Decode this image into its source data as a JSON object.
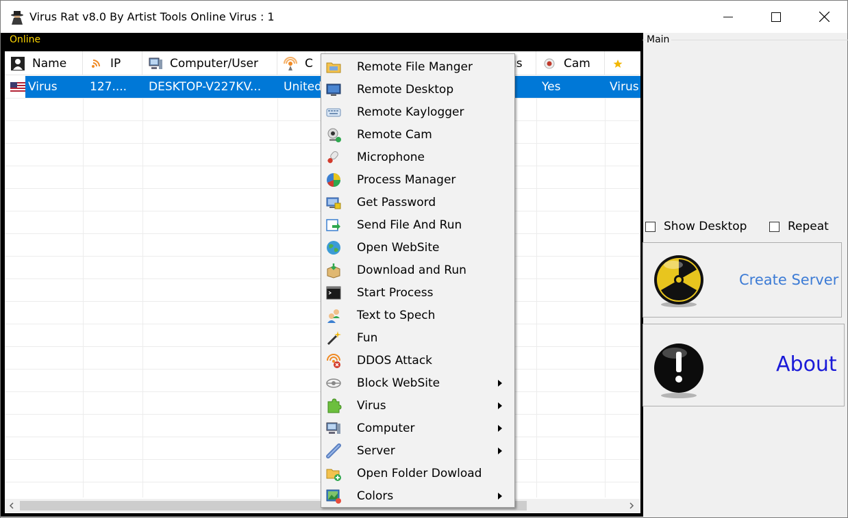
{
  "window": {
    "title": "Virus Rat v8.0 By Artist Tools Online Virus : 1"
  },
  "online_group": {
    "caption": "Online",
    "columns": [
      {
        "label": "Name",
        "icon": "user-icon"
      },
      {
        "label": "IP",
        "icon": "rss-icon"
      },
      {
        "label": "Computer/User",
        "icon": "computer-icon"
      },
      {
        "label": "C",
        "icon": "signal-icon"
      },
      {
        "label": "us",
        "icon": ""
      },
      {
        "label": "Cam",
        "icon": "webcam-icon"
      },
      {
        "label": "",
        "icon": "star-icon"
      }
    ],
    "rows": [
      {
        "name": "Virus",
        "ip": "127....",
        "computer_user": "DESKTOP-V227KV...",
        "country": "United",
        "cam": "Yes",
        "extra": "Virus"
      }
    ]
  },
  "main_group": {
    "caption": "Main",
    "show_desktop": {
      "label": "Show Desktop",
      "checked": false
    },
    "repeat": {
      "label": "Repeat",
      "checked": false
    },
    "create_server_label": "Create Server",
    "about_label": "About"
  },
  "context_menu": {
    "items": [
      {
        "label": "Remote File Manger",
        "icon": "folder-icon",
        "submenu": false
      },
      {
        "label": "Remote Desktop",
        "icon": "desktop-icon",
        "submenu": false
      },
      {
        "label": "Remote Kaylogger",
        "icon": "keyboard-icon",
        "submenu": false
      },
      {
        "label": "Remote Cam",
        "icon": "webcam-icon",
        "submenu": false
      },
      {
        "label": "Microphone",
        "icon": "microphone-icon",
        "submenu": false
      },
      {
        "label": "Process Manager",
        "icon": "pie-chart-icon",
        "submenu": false
      },
      {
        "label": "Get Password",
        "icon": "password-icon",
        "submenu": false
      },
      {
        "label": "Send File And Run",
        "icon": "send-file-icon",
        "submenu": false
      },
      {
        "label": "Open WebSite",
        "icon": "globe-icon",
        "submenu": false
      },
      {
        "label": "Download and Run",
        "icon": "package-icon",
        "submenu": false
      },
      {
        "label": "Start Process",
        "icon": "terminal-icon",
        "submenu": false
      },
      {
        "label": "Text to Spech",
        "icon": "speech-icon",
        "submenu": false
      },
      {
        "label": "Fun",
        "icon": "magic-wand-icon",
        "submenu": false
      },
      {
        "label": "DDOS Attack",
        "icon": "ddos-icon",
        "submenu": false
      },
      {
        "label": "Block WebSite",
        "icon": "block-icon",
        "submenu": true
      },
      {
        "label": "Virus",
        "icon": "puzzle-icon",
        "submenu": true
      },
      {
        "label": "Computer",
        "icon": "computer-icon",
        "submenu": true
      },
      {
        "label": "Server",
        "icon": "server-icon",
        "submenu": true
      },
      {
        "label": "Open Folder Dowload",
        "icon": "open-folder-icon",
        "submenu": false
      },
      {
        "label": "Colors",
        "icon": "colors-icon",
        "submenu": true
      }
    ]
  },
  "colors": {
    "selection": "#0078d7",
    "online_caption": "#ffd700",
    "create_server": "#3c7bd5",
    "about": "#1a1ad8"
  }
}
